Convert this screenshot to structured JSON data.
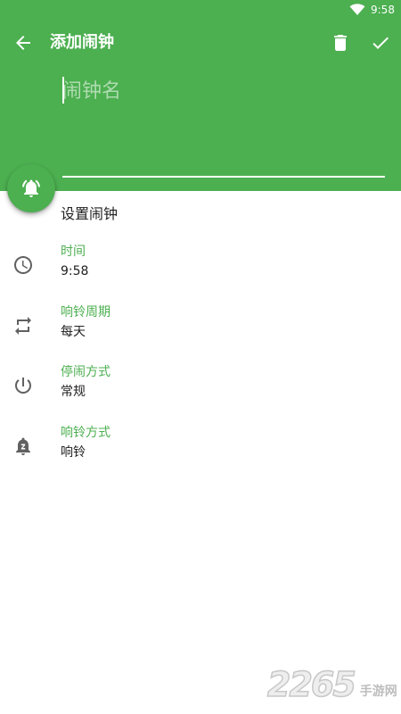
{
  "status_bar": {
    "time": "9:58",
    "wifi_icon": "wifi-icon"
  },
  "toolbar": {
    "title": "添加闹钟",
    "back_icon": "arrow-back-icon",
    "delete_icon": "trash-icon",
    "confirm_icon": "check-icon"
  },
  "name_field": {
    "placeholder": "闹钟名",
    "value": ""
  },
  "fab": {
    "icon": "bell-ringing-icon"
  },
  "section": {
    "title": "设置闹钟"
  },
  "settings": [
    {
      "label": "时间",
      "value": "9:58",
      "icon": "clock-icon"
    },
    {
      "label": "响铃周期",
      "value": "每天",
      "icon": "repeat-icon"
    },
    {
      "label": "停闹方式",
      "value": "常规",
      "icon": "power-icon"
    },
    {
      "label": "响铃方式",
      "value": "响铃",
      "icon": "bell-snooze-icon"
    }
  ],
  "watermark": {
    "number": "2265",
    "text": "手游网",
    "domain": "com"
  },
  "colors": {
    "primary": "#4caf50",
    "on_primary": "#ffffff",
    "text_primary": "#212121",
    "icon_gray": "#616161"
  }
}
